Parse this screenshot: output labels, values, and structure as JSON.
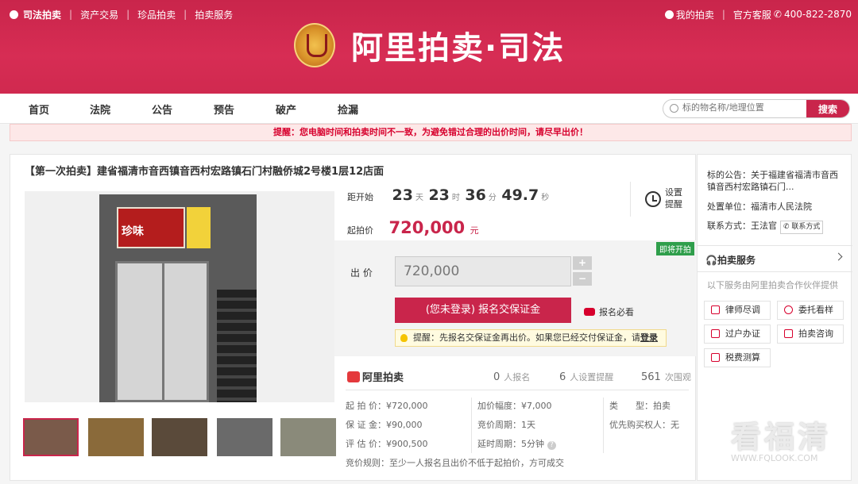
{
  "topbar": {
    "brand": "司法拍卖",
    "links": [
      "资产交易",
      "珍品拍卖",
      "拍卖服务"
    ],
    "my_auction": "我的拍卖",
    "service": "官方客服",
    "phone": "400-822-2870"
  },
  "logo": {
    "text": "阿里拍卖·司法"
  },
  "nav": {
    "items": [
      "首页",
      "法院",
      "公告",
      "预告",
      "破产",
      "捡漏"
    ],
    "search_placeholder": "标的物名称/地理位置",
    "search_button": "搜索"
  },
  "warning": "提醒：您电脑时间和拍卖时间不一致，为避免错过合理的出价时间，请尽早出价！",
  "item": {
    "title": "【第一次拍卖】建省福清市音西镇音西村宏路镇石门村融侨城2号楼1层12店面",
    "sign_text": "珍味",
    "countdown": {
      "label": "距开始",
      "days": "23",
      "days_unit": "天",
      "hours": "23",
      "hours_unit": "时",
      "minutes": "36",
      "minutes_unit": "分",
      "seconds": "49.7",
      "seconds_unit": "秒"
    },
    "start_price": {
      "label": "起拍价",
      "value": "720,000",
      "unit": "元"
    },
    "remind": {
      "label": "设置提醒"
    },
    "tag": "即将开拍",
    "bid": {
      "label": "出 价",
      "value": "720,000",
      "plus": "+",
      "minus": "−",
      "deposit_button": "(您未登录) 报名交保证金",
      "must_read": "报名必看",
      "tip": "提醒：先报名交保证金再出价。如果您已经交付保证金，请",
      "login": "登录"
    },
    "stats": {
      "brand": "阿里拍卖",
      "signups": "0",
      "signups_label": "人报名",
      "reminders": "6",
      "reminders_label": "人设置提醒",
      "views": "561",
      "views_label": "次围观"
    },
    "details": {
      "start_price": {
        "k": "起 拍 价：",
        "v": "¥720,000"
      },
      "deposit": {
        "k": "保 证 金：",
        "v": "¥90,000"
      },
      "appraisal": {
        "k": "评 估 价：",
        "v": "¥900,500"
      },
      "increment": {
        "k": "加价幅度：",
        "v": "¥7,000"
      },
      "period": {
        "k": "竞价周期：",
        "v": "1天"
      },
      "delay": {
        "k": "延时周期：",
        "v": "5分钟"
      },
      "type": {
        "k": "类　　型：",
        "v": "拍卖"
      },
      "priority": {
        "k": "优先购买权人",
        "v": "：无"
      },
      "rule": {
        "k": "竞价规则：",
        "v": "至少一人报名且出价不低于起拍价，方可成交"
      }
    }
  },
  "side": {
    "notice_label": "标的公告：",
    "notice_text": "关于福建省福清市音西镇音西村宏路镇石门...",
    "court_label": "处置单位：",
    "court": "福清市人民法院",
    "contact_label": "联系方式：",
    "contact": "王法官",
    "contact_btn": "联系方式",
    "service_title": "拍卖服务",
    "service_desc": "以下服务由阿里拍卖合作伙伴提供",
    "services": [
      "律师尽调",
      "委托看样",
      "过户办证",
      "拍卖咨询",
      "税费测算"
    ]
  },
  "watermark": {
    "big": "看福清",
    "small": "WWW.FQLOOK.COM"
  }
}
